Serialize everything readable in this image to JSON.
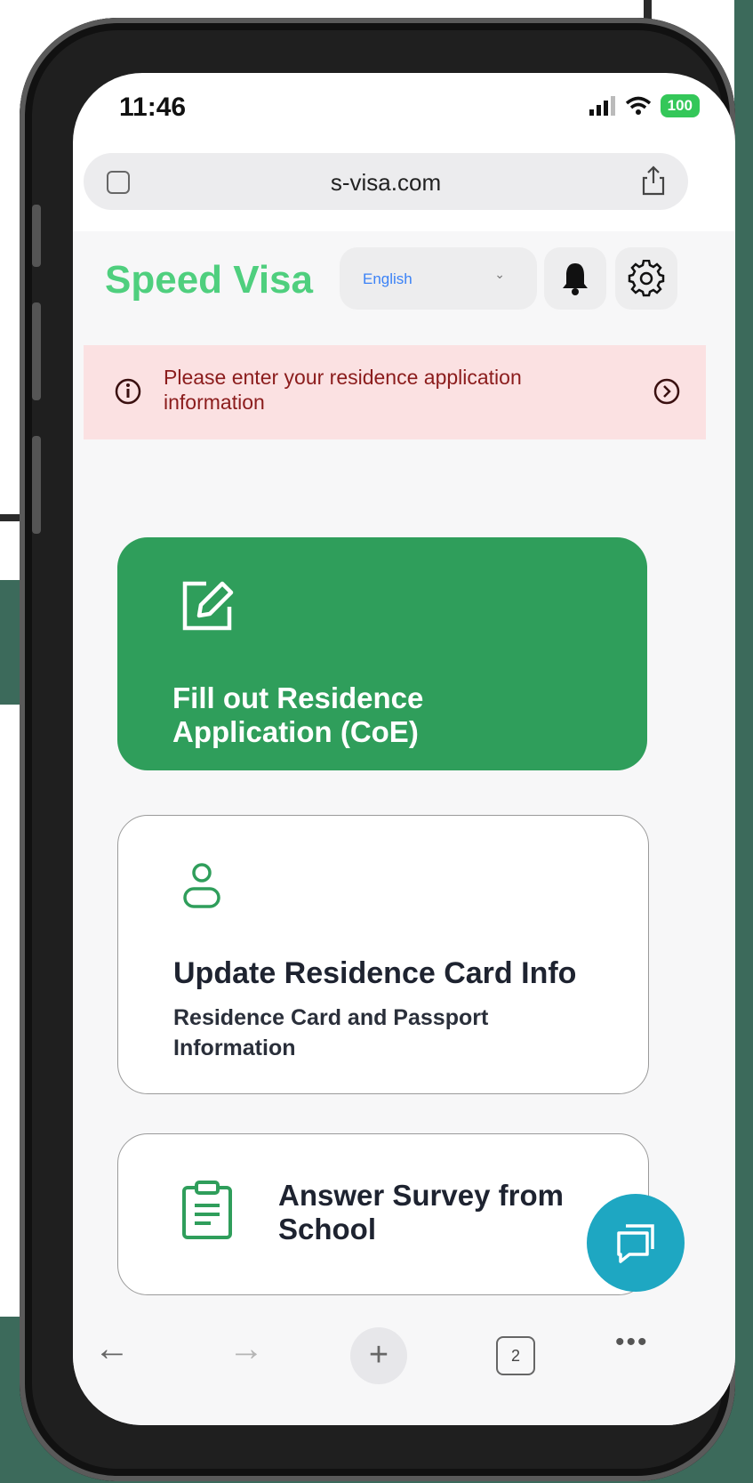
{
  "status_bar": {
    "time": "11:46",
    "battery": "100"
  },
  "browser": {
    "url": "s-visa.com"
  },
  "header": {
    "brand": "Speed Visa",
    "language": "English"
  },
  "alert": {
    "text": "Please enter your residence application information"
  },
  "cards": {
    "coe": {
      "title_line1": "Fill out Residence",
      "title_line2": "Application (CoE)"
    },
    "residence_card": {
      "title": "Update Residence Card Info",
      "subtitle": "Residence Card and Passport Information"
    },
    "survey": {
      "title_line1": "Answer Survey from",
      "title_line2": "School"
    }
  },
  "toolbar": {
    "tab_count": "2"
  },
  "colors": {
    "brand": "#4fcf7e",
    "primary_card": "#2f9e5b",
    "alert_bg": "#fbe1e2",
    "alert_text": "#8b1c1c",
    "chat_fab": "#1ea7c2"
  },
  "icons": [
    "location-icon",
    "signal-icon",
    "wifi-icon",
    "share-icon",
    "bell-icon",
    "gear-icon",
    "info-icon",
    "chevron-right-icon",
    "edit-icon",
    "user-icon",
    "clipboard-icon",
    "chat-icon",
    "back-arrow-icon",
    "forward-arrow-icon",
    "plus-icon",
    "tabs-icon",
    "more-icon"
  ]
}
